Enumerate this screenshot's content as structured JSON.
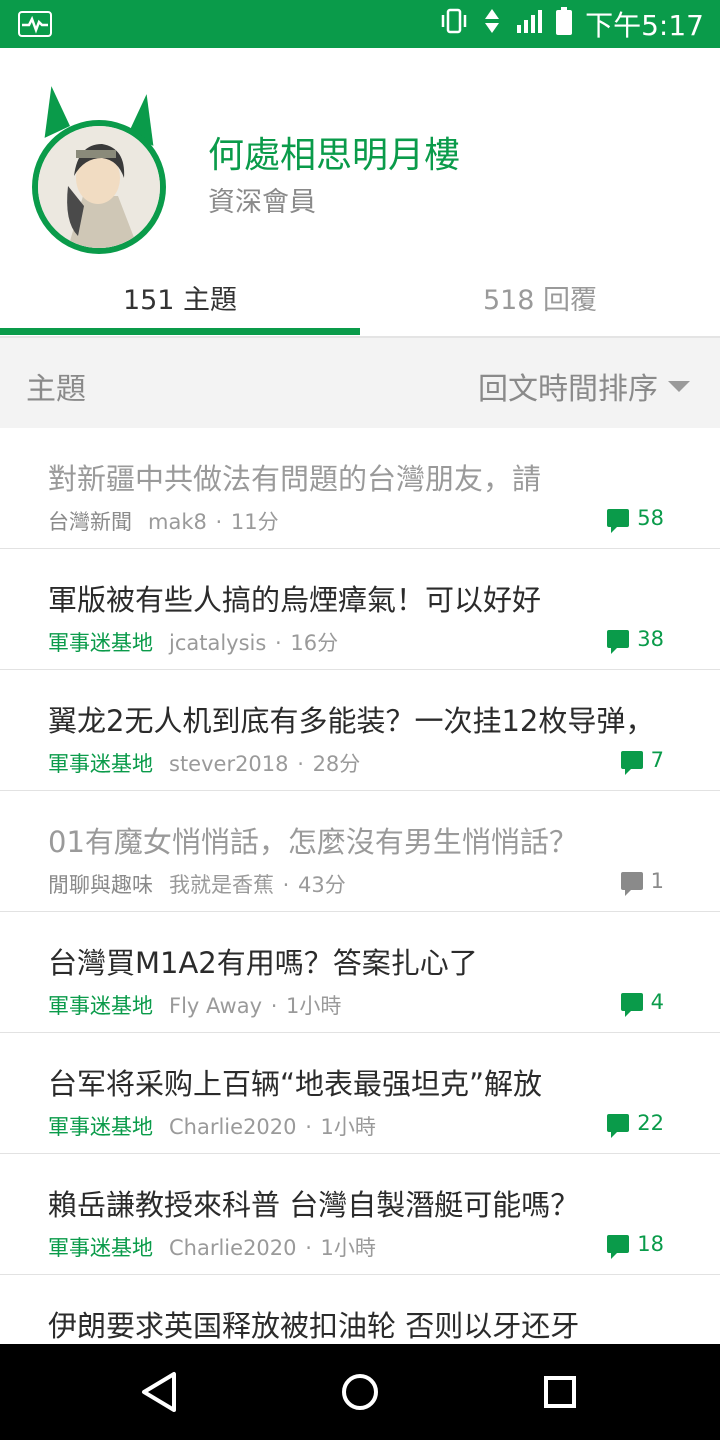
{
  "status_bar": {
    "time": "下午5:17",
    "app_icon": "activity-icon",
    "icons": [
      "vibrate-icon",
      "network-4g-icon",
      "signal-icon",
      "battery-icon"
    ],
    "color": "#0a9b4a"
  },
  "profile": {
    "name": "何處相思明月樓",
    "role": "資深會員"
  },
  "tabs": [
    {
      "label": "151 主題",
      "active": true
    },
    {
      "label": "518 回覆",
      "active": false
    }
  ],
  "section": {
    "title": "主題",
    "sort_label": "回文時間排序"
  },
  "posts": [
    {
      "title": "對新疆中共做法有問題的台灣朋友，請",
      "forum": "台灣新聞",
      "author": "mak8",
      "time": "11分",
      "comments": "58",
      "read": true,
      "comment_grey": false
    },
    {
      "title": "軍版被有些人搞的烏煙瘴氣！可以好好",
      "forum": "軍事迷基地",
      "author": "jcatalysis",
      "time": "16分",
      "comments": "38",
      "read": false,
      "comment_grey": false
    },
    {
      "title": "翼龙2无人机到底有多能装？一次挂12枚导弹，",
      "forum": "軍事迷基地",
      "author": "stever2018",
      "time": "28分",
      "comments": "7",
      "read": false,
      "comment_grey": false
    },
    {
      "title": "01有魔女悄悄話，怎麼沒有男生悄悄話？",
      "forum": "閒聊與趣味",
      "author": "我就是香蕉",
      "time": "43分",
      "comments": "1",
      "read": true,
      "comment_grey": true
    },
    {
      "title": "台灣買M1A2有用嗎？答案扎心了",
      "forum": "軍事迷基地",
      "author": "Fly Away",
      "time": "1小時",
      "comments": "4",
      "read": false,
      "comment_grey": false
    },
    {
      "title": "台军将采购上百辆“地表最强坦克”解放",
      "forum": "軍事迷基地",
      "author": "Charlie2020",
      "time": "1小時",
      "comments": "22",
      "read": false,
      "comment_grey": false
    },
    {
      "title": "賴岳謙教授來科普 台灣自製潛艇可能嗎？",
      "forum": "軍事迷基地",
      "author": "Charlie2020",
      "time": "1小時",
      "comments": "18",
      "read": false,
      "comment_grey": false
    },
    {
      "title": "伊朗要求英国释放被扣油轮 否则以牙还牙",
      "forum": "",
      "author": "",
      "time": "",
      "comments": "",
      "read": false,
      "comment_grey": false
    }
  ],
  "nav": {
    "back": "back-icon",
    "home": "home-icon",
    "recents": "recents-icon"
  }
}
